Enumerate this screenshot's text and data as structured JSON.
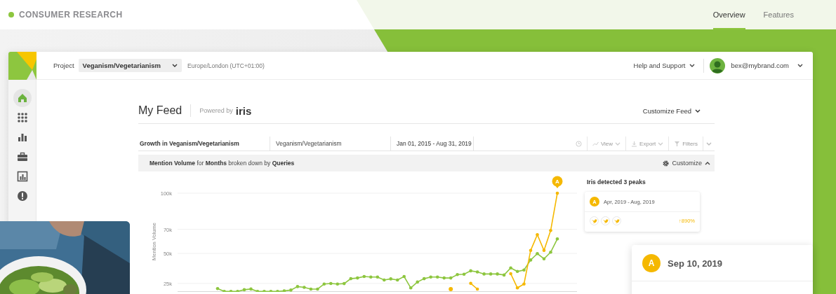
{
  "site_header": {
    "brand": "CONSUMER RESEARCH",
    "nav": [
      {
        "label": "Overview",
        "selected": true
      },
      {
        "label": "Features",
        "selected": false
      }
    ]
  },
  "app": {
    "top_bar": {
      "project_label": "Project",
      "project": "Veganism/Vegetarianism",
      "timezone": "Europe/London (UTC+01:00)",
      "help": "Help and Support",
      "user": "bex@mybrand.com"
    },
    "sidebar": {
      "items": [
        {
          "kind": "home",
          "selected": true
        },
        {
          "kind": "apps",
          "selected": false
        },
        {
          "kind": "bars",
          "selected": false
        },
        {
          "kind": "briefcase",
          "selected": false
        },
        {
          "kind": "report",
          "selected": false
        },
        {
          "kind": "alert",
          "selected": false
        }
      ]
    },
    "feed": {
      "title": "My Feed",
      "powered_by": "Powered by",
      "brand": "iris",
      "customize": "Customize Feed"
    },
    "widget": {
      "columns": [
        "Growth in Veganism/Vegetarianism",
        "Veganism/Vegetarianism",
        "Jan 01, 2015 - Aug 31, 2019"
      ],
      "tools": [
        {
          "kind": "clock"
        },
        {
          "kind": "view",
          "label": "View"
        },
        {
          "kind": "export",
          "label": "Export"
        },
        {
          "kind": "filter",
          "label": "Filters"
        },
        {
          "kind": "more"
        }
      ],
      "summary": "**Mention Volume** for **Months** broken down by **Queries**",
      "customize": "Customize",
      "chart_data": {
        "type": "line",
        "ylabel": "Mention Volume",
        "grid": true,
        "ylim": [
          18000,
          100000
        ],
        "yticks": [
          {
            "value": 25000,
            "label": "25k"
          },
          {
            "value": 50000,
            "label": "50k"
          },
          {
            "value": 70000,
            "label": "70k"
          },
          {
            "value": 100000,
            "label": "100k"
          }
        ],
        "series": [
          {
            "color": "#8dc63f",
            "values": [
              20800,
              18400,
              18400,
              18400,
              19800,
              20400,
              18400,
              18400,
              18400,
              18400,
              18800,
              19500,
              22400,
              21800,
              20300,
              20300,
              24600,
              25000,
              24600,
              24900,
              29000,
              29600,
              30800,
              30300,
              30300,
              27900,
              28800,
              27900,
              30800,
              21300,
              26200,
              29000,
              30300,
              30300,
              29600,
              29600,
              32400,
              32700,
              35500,
              34600,
              32900,
              32900,
              32900,
              32000,
              37900,
              35000,
              36200,
              44500,
              49800,
              45500,
              51000,
              62000
            ]
          },
          {
            "color": "#f5b800",
            "values": [
              null,
              null,
              null,
              null,
              null,
              null,
              null,
              null,
              null,
              null,
              null,
              null,
              null,
              null,
              null,
              null,
              null,
              null,
              null,
              null,
              null,
              null,
              null,
              null,
              null,
              null,
              null,
              null,
              null,
              null,
              null,
              null,
              null,
              null,
              null,
              20300,
              null,
              null,
              25100,
              20300,
              null,
              null,
              null,
              null,
              33100,
              21300,
              24600,
              52500,
              65500,
              52500,
              69000,
              100000
            ]
          }
        ],
        "annotations": [
          {
            "y": 100000,
            "text": "A"
          }
        ]
      },
      "peaks": {
        "title": "Iris detected 3 peaks",
        "items": [
          {
            "badge": "A",
            "range": "Apr, 2019 - Aug, 2019",
            "sources": [
              {
                "kind": "twitter"
              },
              {
                "kind": "twitter"
              },
              {
                "kind": "twitter"
              }
            ],
            "change": "↑890%"
          }
        ]
      }
    }
  },
  "event_card": {
    "badge": "A",
    "date": "Sep 10, 2019"
  }
}
